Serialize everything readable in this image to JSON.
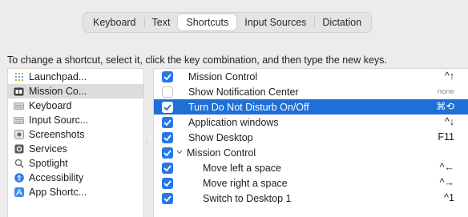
{
  "tabs": [
    {
      "label": "Keyboard",
      "active": false
    },
    {
      "label": "Text",
      "active": false
    },
    {
      "label": "Shortcuts",
      "active": true
    },
    {
      "label": "Input Sources",
      "active": false
    },
    {
      "label": "Dictation",
      "active": false
    }
  ],
  "instruction": "To change a shortcut, select it, click the key combination, and then type the new keys.",
  "categories": [
    {
      "label": "Launchpad...",
      "icon": "launchpad-icon",
      "selected": false
    },
    {
      "label": "Mission Co...",
      "icon": "mission-control-icon",
      "selected": true
    },
    {
      "label": "Keyboard",
      "icon": "keyboard-icon",
      "selected": false
    },
    {
      "label": "Input Sourc...",
      "icon": "input-sources-icon",
      "selected": false
    },
    {
      "label": "Screenshots",
      "icon": "screenshots-icon",
      "selected": false
    },
    {
      "label": "Services",
      "icon": "services-icon",
      "selected": false
    },
    {
      "label": "Spotlight",
      "icon": "spotlight-icon",
      "selected": false
    },
    {
      "label": "Accessibility",
      "icon": "accessibility-icon",
      "selected": false
    },
    {
      "label": "App Shortc...",
      "icon": "app-shortcuts-icon",
      "selected": false
    }
  ],
  "shortcuts": [
    {
      "label": "Mission Control",
      "keys": "^↑",
      "checked": true,
      "selected": false
    },
    {
      "label": "Show Notification Center",
      "keys": "none",
      "checked": false,
      "selected": false
    },
    {
      "label": "Turn Do Not Disturb On/Off",
      "keys": "⌘⟲",
      "checked": true,
      "selected": true
    },
    {
      "label": "Application windows",
      "keys": "^↓",
      "checked": true,
      "selected": false
    },
    {
      "label": "Show Desktop",
      "keys": "F11",
      "checked": true,
      "selected": false
    },
    {
      "label": "Mission Control",
      "keys": "",
      "checked": true,
      "selected": false,
      "group": true,
      "expanded": true
    },
    {
      "label": "Move left a space",
      "keys": "^←",
      "checked": true,
      "selected": false
    },
    {
      "label": "Move right a space",
      "keys": "^→",
      "checked": true,
      "selected": false
    },
    {
      "label": "Switch to Desktop 1",
      "keys": "^1",
      "checked": true,
      "selected": false
    }
  ],
  "colors": {
    "accent": "#2677ea",
    "selection": "#1f6fd6",
    "background": "#ececec"
  }
}
